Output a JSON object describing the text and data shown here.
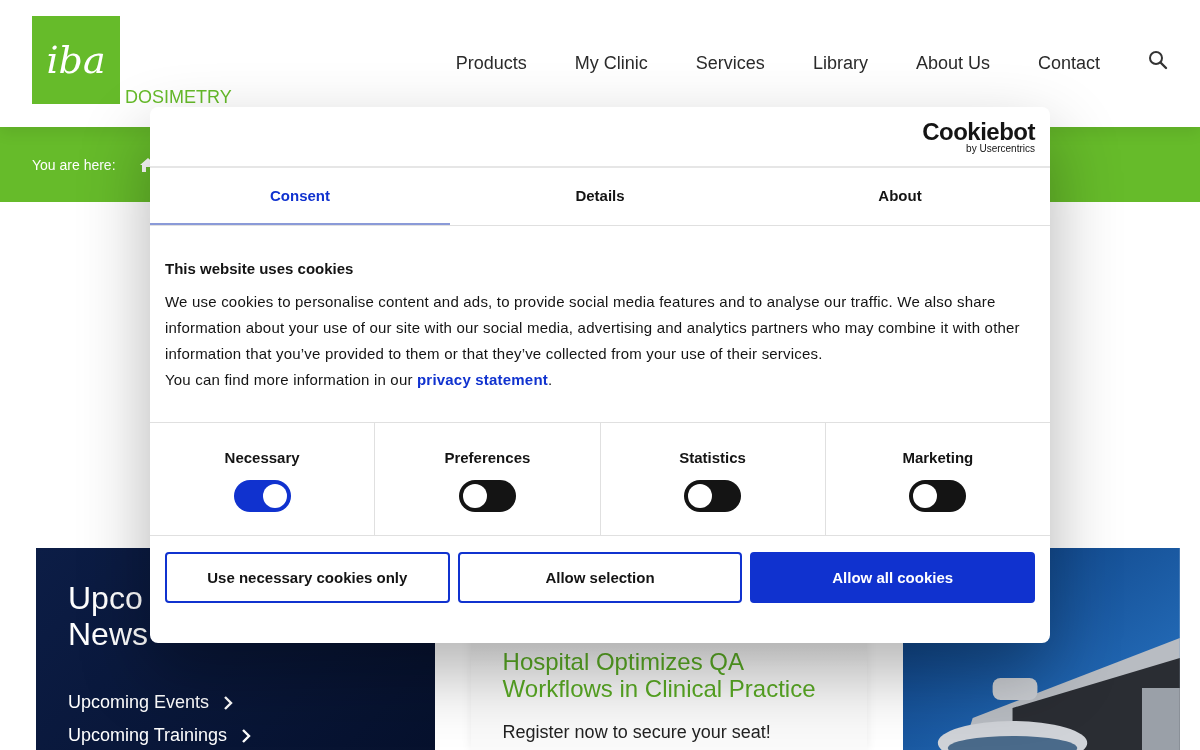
{
  "header": {
    "logo_text": "iba",
    "brand_suffix": "DOSIMETRY",
    "nav": [
      "Products",
      "My Clinic",
      "Services",
      "Library",
      "About Us",
      "Contact"
    ]
  },
  "breadcrumb": {
    "label": "You are here:"
  },
  "cards": {
    "news": {
      "heading_lines": [
        "Upco",
        "News"
      ],
      "links": [
        "Upcoming Events",
        "Upcoming Trainings"
      ]
    },
    "event": {
      "title": "Hospital Optimizes QA Workflows in Clinical Practice",
      "text": "Register now to secure your seat!"
    }
  },
  "cookie_dialog": {
    "brand": "Cookiebot",
    "brand_sub": "by Usercentrics",
    "tabs": [
      {
        "label": "Consent",
        "selected": true
      },
      {
        "label": "Details",
        "selected": false
      },
      {
        "label": "About",
        "selected": false
      }
    ],
    "title": "This website uses cookies",
    "body": "We use cookies to personalise content and ads, to provide social media features and to analyse our traffic. We also share information about your use of our site with our social media, advertising and analytics partners who may combine it with other information that you’ve provided to them or that they’ve collected from your use of their services.",
    "more_prefix": "You can find more information in our ",
    "more_link": "privacy statement",
    "more_suffix": ".",
    "toggles": [
      {
        "label": "Necessary",
        "on": true
      },
      {
        "label": "Preferences",
        "on": false
      },
      {
        "label": "Statistics",
        "on": false
      },
      {
        "label": "Marketing",
        "on": false
      }
    ],
    "buttons": [
      {
        "label": "Use necessary cookies only",
        "kind": "outline"
      },
      {
        "label": "Allow selection",
        "kind": "outline"
      },
      {
        "label": "Allow all cookies",
        "kind": "primary"
      }
    ]
  }
}
